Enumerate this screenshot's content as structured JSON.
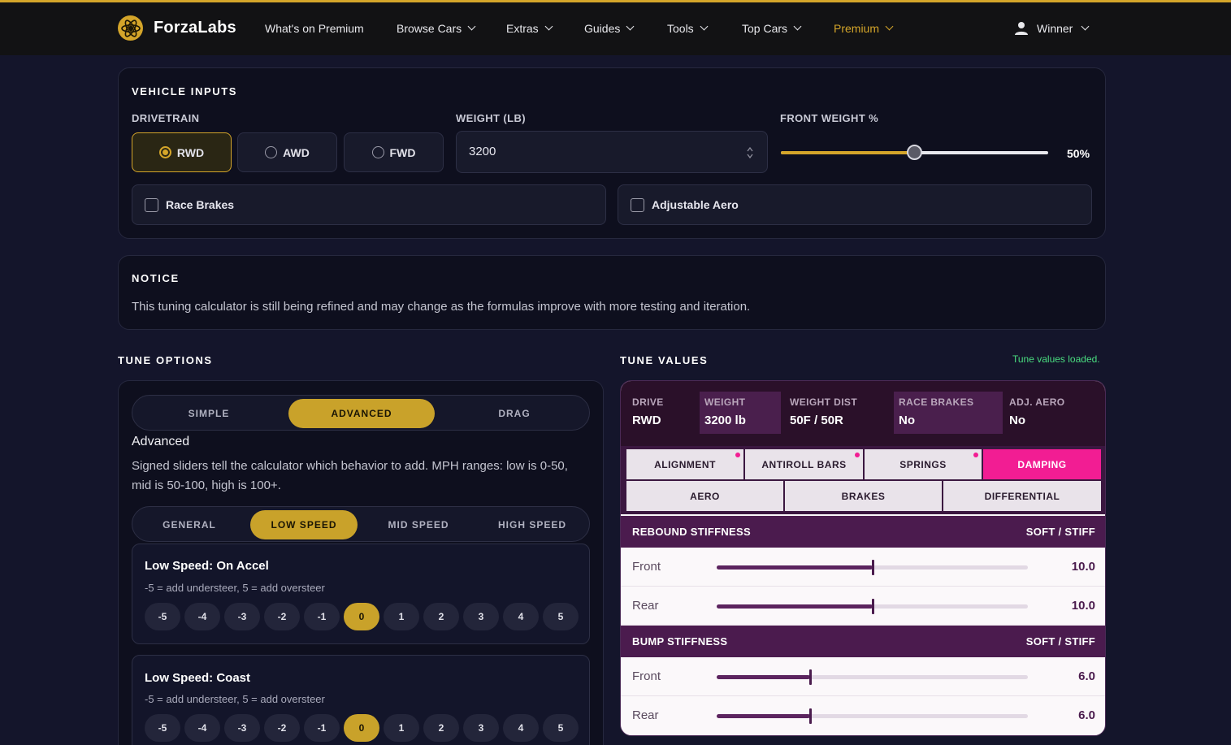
{
  "nav": {
    "brand": "ForzaLabs",
    "items": [
      {
        "label": "What's on Premium",
        "dropdown": false
      },
      {
        "label": "Browse Cars",
        "dropdown": true
      },
      {
        "label": "Extras",
        "dropdown": true
      },
      {
        "label": "Guides",
        "dropdown": true
      },
      {
        "label": "Tools",
        "dropdown": true
      },
      {
        "label": "Top Cars",
        "dropdown": true
      },
      {
        "label": "Premium",
        "dropdown": true
      }
    ],
    "user": "Winner"
  },
  "vehicle_inputs": {
    "title": "VEHICLE INPUTS",
    "drivetrain_label": "DRIVETRAIN",
    "drivetrain_options": [
      "RWD",
      "AWD",
      "FWD"
    ],
    "drivetrain_selected": "RWD",
    "weight_label": "WEIGHT (LB)",
    "weight_value": "3200",
    "front_weight_label": "FRONT WEIGHT %",
    "front_weight_value": "50%",
    "front_weight_fraction": 0.5,
    "race_brakes_label": "Race Brakes",
    "race_brakes_checked": false,
    "adjustable_aero_label": "Adjustable Aero",
    "adjustable_aero_checked": false
  },
  "notice": {
    "title": "NOTICE",
    "text": "This tuning calculator is still being refined and may change as the formulas improve with more testing and iteration."
  },
  "tune_options": {
    "title": "TUNE OPTIONS",
    "modes": [
      "SIMPLE",
      "ADVANCED",
      "DRAG"
    ],
    "mode_selected": "ADVANCED",
    "mode_heading": "Advanced",
    "mode_description": "Signed sliders tell the calculator which behavior to add. MPH ranges: low is 0-50, mid is 50-100, high is 100+.",
    "speed_tabs": [
      "GENERAL",
      "LOW SPEED",
      "MID SPEED",
      "HIGH SPEED"
    ],
    "speed_selected": "LOW SPEED",
    "scale": [
      "-5",
      "-4",
      "-3",
      "-2",
      "-1",
      "0",
      "1",
      "2",
      "3",
      "4",
      "5"
    ],
    "groups": [
      {
        "title": "Low Speed: On Accel",
        "hint": "-5 = add understeer, 5 = add oversteer",
        "selected": "0"
      },
      {
        "title": "Low Speed: Coast",
        "hint": "-5 = add understeer, 5 = add oversteer",
        "selected": "0"
      }
    ]
  },
  "tune_values": {
    "title": "TUNE VALUES",
    "status": "Tune values loaded.",
    "summary": [
      {
        "key": "DRIVE",
        "value": "RWD"
      },
      {
        "key": "WEIGHT",
        "value": "3200 lb"
      },
      {
        "key": "WEIGHT DIST",
        "value": "50F / 50R"
      },
      {
        "key": "RACE BRAKES",
        "value": "No"
      },
      {
        "key": "ADJ. AERO",
        "value": "No"
      }
    ],
    "tabs_row1": [
      {
        "label": "ALIGNMENT",
        "dot": true
      },
      {
        "label": "ANTIROLL BARS",
        "dot": true
      },
      {
        "label": "SPRINGS",
        "dot": true
      },
      {
        "label": "DAMPING",
        "dot": false,
        "active": true
      }
    ],
    "tabs_row2": [
      {
        "label": "AERO"
      },
      {
        "label": "BRAKES"
      },
      {
        "label": "DIFFERENTIAL"
      }
    ],
    "sections": [
      {
        "title": "REBOUND STIFFNESS",
        "range_label": "SOFT / STIFF",
        "rows": [
          {
            "name": "Front",
            "value": "10.0",
            "fraction": 0.5
          },
          {
            "name": "Rear",
            "value": "10.0",
            "fraction": 0.5
          }
        ]
      },
      {
        "title": "BUMP STIFFNESS",
        "range_label": "SOFT / STIFF",
        "rows": [
          {
            "name": "Front",
            "value": "6.0",
            "fraction": 0.3
          },
          {
            "name": "Rear",
            "value": "6.0",
            "fraction": 0.3
          }
        ]
      }
    ]
  },
  "colors": {
    "accent_gold": "#d4a52a",
    "accent_pink": "#f21d93",
    "plum": "#4b1b4e",
    "status_green": "#4ade80"
  }
}
